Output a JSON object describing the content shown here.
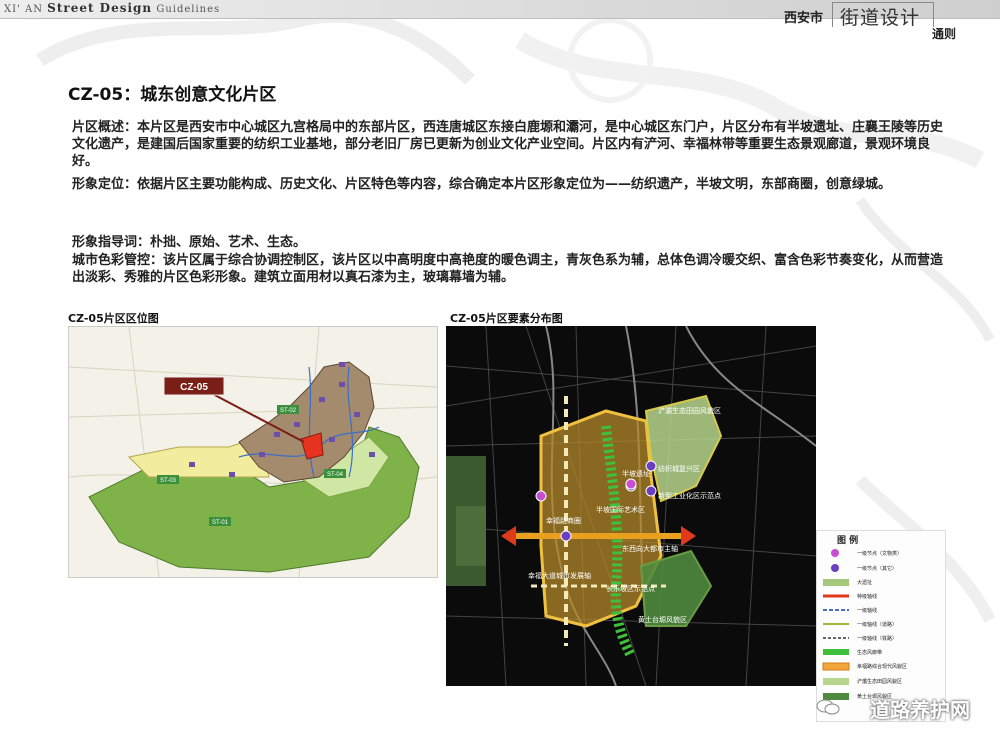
{
  "header": {
    "prefix": "XI' AN",
    "series": "Street Design",
    "suffix": "Guidelines",
    "city": "西安市",
    "main_title": "街道设计",
    "subtitle": "通则"
  },
  "title": "CZ-05：城东创意文化片区",
  "paragraphs": {
    "overview": "片区概述：本片区是西安市中心城区九宫格局中的东部片区，西连唐城区东接白鹿塬和灞河，是中心城区东门户，片区分布有半坡遗址、庄襄王陵等历史文化遗产，是建国后国家重要的纺织工业基地，部分老旧厂房已更新为创业文化产业空间。片区内有浐河、幸福林带等重要生态景观廊道，景观环境良好。",
    "positioning": "形象定位：依据片区主要功能构成、历史文化、片区特色等内容，综合确定本片区形象定位为——纺织遗产，半坡文明，东部商圈，创意绿城。",
    "keywords": "形象指导词：朴拙、原始、艺术、生态。",
    "color": "城市色彩管控：该片区属于综合协调控制区，该片区以中高明度中高艳度的暖色调主，青灰色系为辅，总体色调冷暖交织、富含色彩节奏变化，从而营造出淡彩、秀雅的片区色彩形象。建筑立面用材以真石漆为主，玻璃幕墙为辅。"
  },
  "location_map": {
    "caption": "CZ-05片区区位图",
    "callout": "CZ-05",
    "zones": [
      "ST-02",
      "ST-03",
      "ST-04",
      "ST-01"
    ]
  },
  "elements_map": {
    "caption": "CZ-05片区要素分布图",
    "labels": [
      "浐灞生态田园风貌区",
      "纺织城复兴区",
      "新型工业化区示范点",
      "半坡遗址",
      "半坡国际艺术区",
      "东西向大都市主轴",
      "幸福路商圈",
      "幸福大道城市发展轴",
      "长乐坡区示范点",
      "黄土台塬风貌区"
    ],
    "legend_title": "图 例",
    "legend": [
      "一级节点（文物类）",
      "一级节点（其它）",
      "大遗址",
      "特级轴线",
      "一级轴线",
      "一级轴线（道路）",
      "一级轴线（铁路）",
      "生态风廊带",
      "幸福路综合现代风貌区",
      "浐灞生态田园风貌区",
      "黄土台塬风貌区"
    ]
  },
  "watermark": "道路养护网",
  "colors": {
    "zone_green": "#7fb34a",
    "zone_yellow": "#f2ec9e",
    "district_brown": "#a58b6e",
    "highlight_red": "#e53320",
    "axis_orange": "#e8a020",
    "axis_red": "#e03a1a",
    "callout_maroon": "#7a1f17"
  }
}
